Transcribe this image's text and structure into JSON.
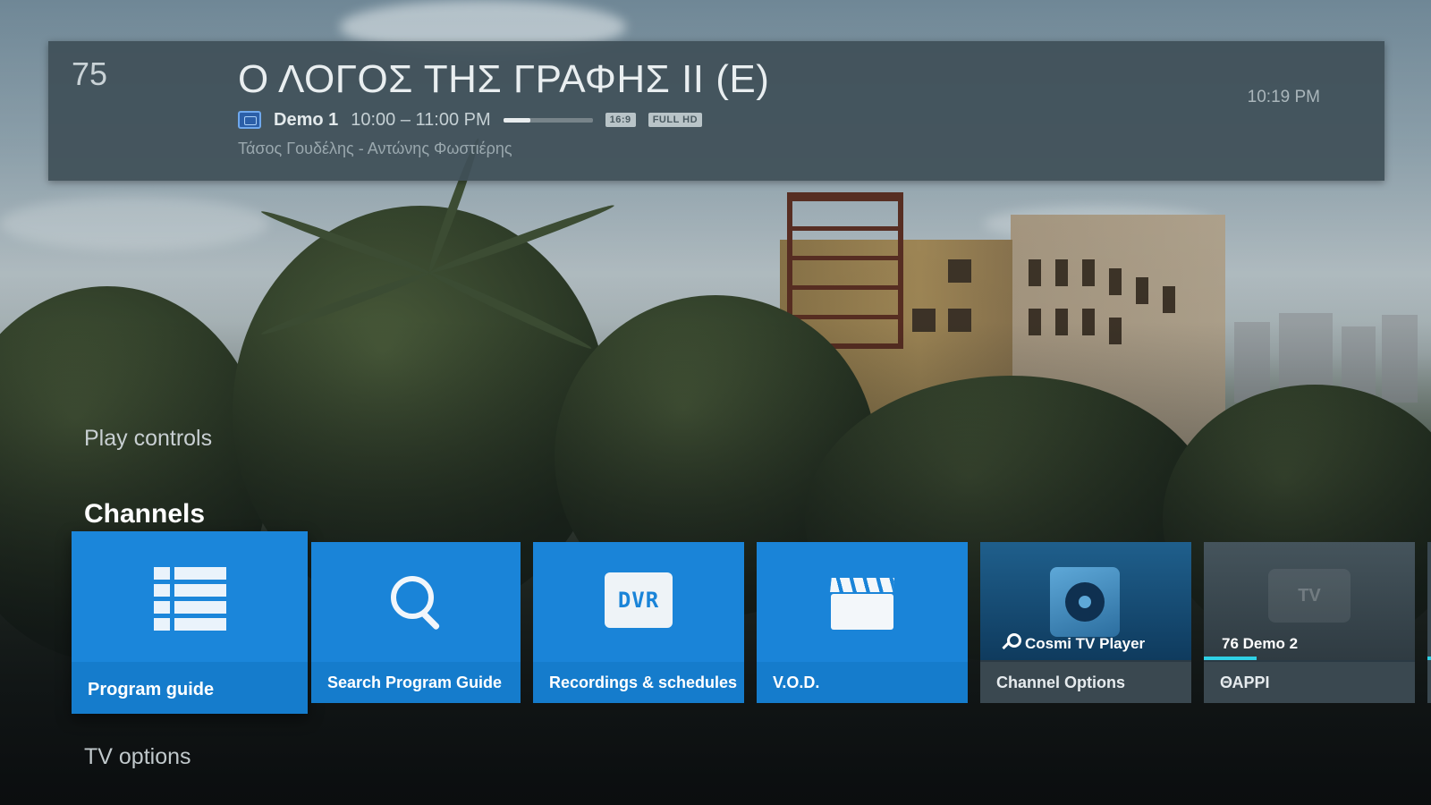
{
  "info_banner": {
    "channel_number": "75",
    "program_title": "Ο ΛΟΓΟΣ ΤΗΣ ΓΡΑΦΗΣ II (Ε)",
    "channel_name": "Demo 1",
    "time_range": "10:00 – 11:00 PM",
    "progress": 0.3,
    "badges": [
      "16:9",
      "FULL HD"
    ],
    "description": "Τάσος Γουδέλης - Αντώνης Φωστιέρης",
    "clock": "10:19 PM"
  },
  "menu": {
    "play_controls_label": "Play controls",
    "channels_label": "Channels",
    "tv_options_label": "TV options"
  },
  "cards": [
    {
      "label": "Program guide",
      "icon": "list-icon"
    },
    {
      "label": "Search Program Guide",
      "icon": "search-icon"
    },
    {
      "label": "Recordings & schedules",
      "icon": "dvr-icon",
      "icon_text": "DVR"
    },
    {
      "label": "V.O.D.",
      "icon": "clapper-icon"
    },
    {
      "label": "Channel Options",
      "icon": "gear-icon",
      "caption": "Cosmi TV Player"
    },
    {
      "label": "ΘΑΡΡΙ",
      "icon": "tv-logo-icon",
      "caption": "76 Demo 2",
      "logo_text": "TV",
      "progress": 0.25
    }
  ],
  "colors": {
    "card_blue": "#1a84d8",
    "banner_bg": "#405058",
    "progress_cyan": "#2fd1e6"
  }
}
